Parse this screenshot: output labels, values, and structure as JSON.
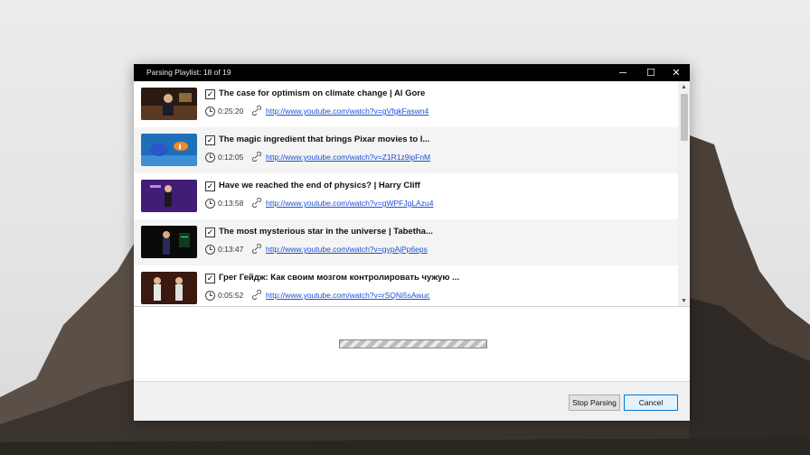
{
  "window": {
    "title": "Parsing Playlist: 18 of 19",
    "controls": {
      "minimize": "─",
      "maximize": "☐",
      "close": "✕"
    }
  },
  "scrollbar": {
    "up": "▲",
    "down": "▼"
  },
  "checkbox_mark": "✓",
  "items": [
    {
      "title": "The case for optimism on climate change | Al Gore",
      "duration": "0:25:20",
      "url": "http://www.youtube.com/watch?v=gVfgkFaswn4",
      "checked": true
    },
    {
      "title": "The magic ingredient that brings Pixar movies to l...",
      "duration": "0:12:05",
      "url": "http://www.youtube.com/watch?v=Z1R1z9ipFnM",
      "checked": true
    },
    {
      "title": "Have we reached the end of physics? | Harry Cliff",
      "duration": "0:13:58",
      "url": "http://www.youtube.com/watch?v=gWPFJgLAzu4",
      "checked": true
    },
    {
      "title": "The most mysterious star in the universe | Tabetha...",
      "duration": "0:13:47",
      "url": "http://www.youtube.com/watch?v=gypAjPp6eps",
      "checked": true
    },
    {
      "title": "Грег Гейдж: Как своим мозгом контролировать чужую ...",
      "duration": "0:05:52",
      "url": "http://www.youtube.com/watch?v=rSQNi5sAwuc",
      "checked": true
    }
  ],
  "buttons": {
    "stop": "Stop Parsing",
    "cancel": "Cancel"
  },
  "colors": {
    "link": "#1a4fd6",
    "titlebar": "#000000",
    "accent": "#0078d7"
  }
}
